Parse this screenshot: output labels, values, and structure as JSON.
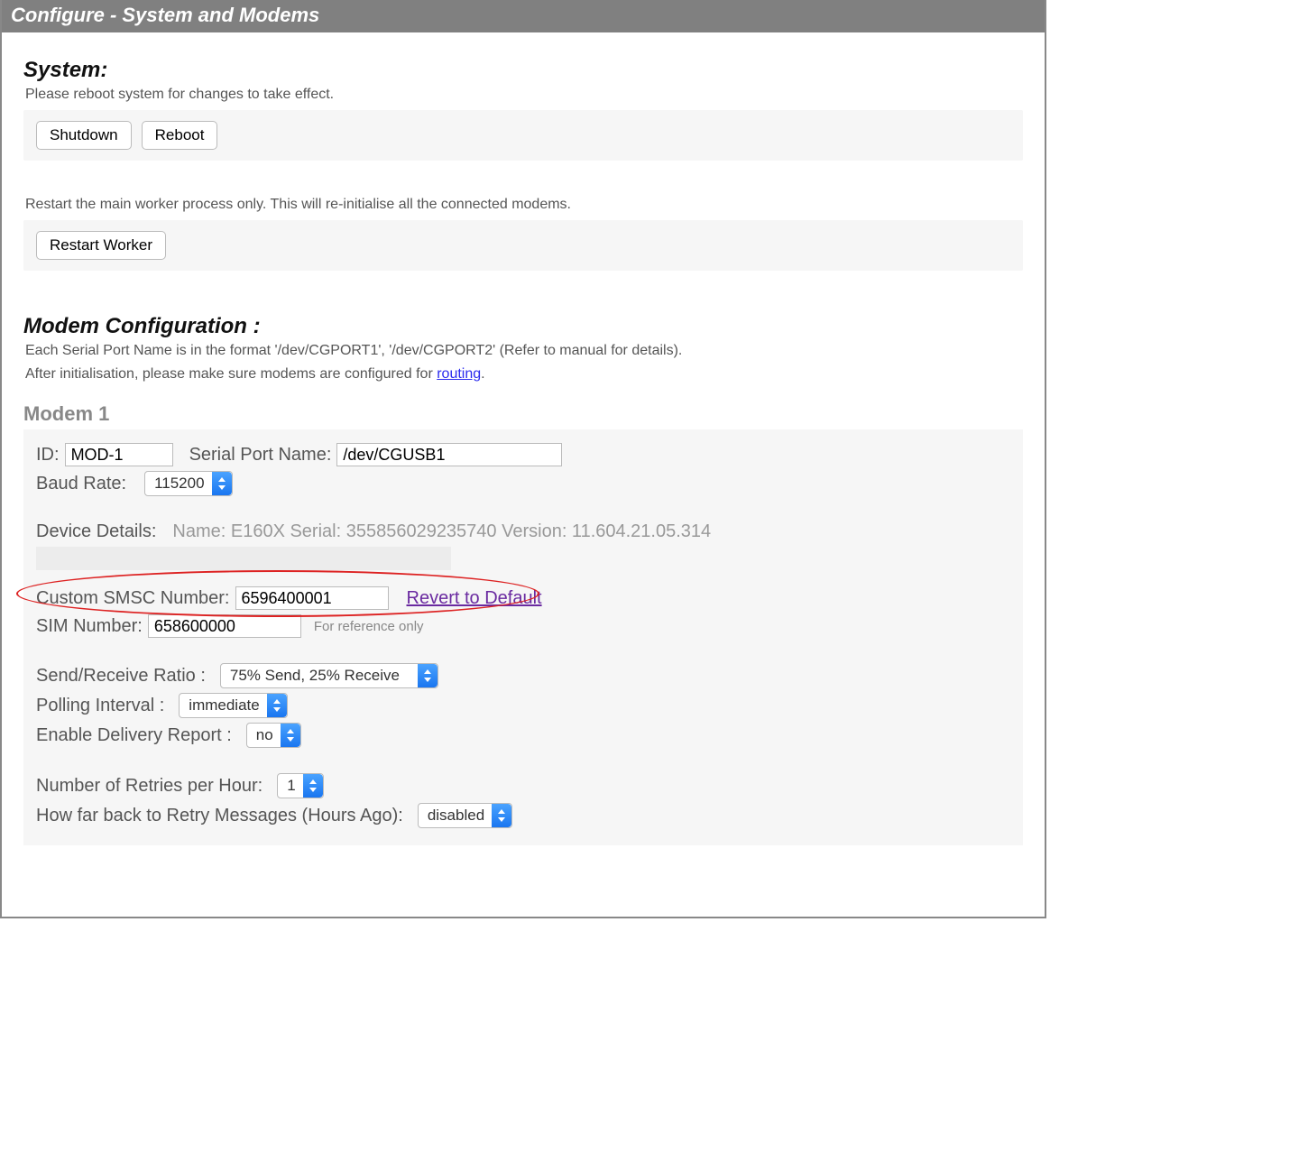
{
  "titlebar": "Configure - System and Modems",
  "system": {
    "heading": "System:",
    "note1": "Please reboot system for changes to take effect.",
    "shutdown_label": "Shutdown",
    "reboot_label": "Reboot",
    "note2": "Restart the main worker process only. This will re-initialise all the connected modems.",
    "restart_worker_label": "Restart Worker"
  },
  "modemcfg": {
    "heading": "Modem Configuration :",
    "note_line1": "Each Serial Port Name is in the format '/dev/CGPORT1', '/dev/CGPORT2' (Refer to manual for details).",
    "note_line2a": "After initialisation, please make sure modems are configured for ",
    "routing_link": "routing",
    "note_line2b": "."
  },
  "modem1": {
    "heading": "Modem 1",
    "id_label": "ID:",
    "id_value": "MOD-1",
    "serial_port_label": "Serial Port Name:",
    "serial_port_value": "/dev/CGUSB1",
    "baud_label": "Baud Rate:",
    "baud_value": "115200",
    "device_details_label": "Device Details:",
    "device_details_value": "Name: E160X Serial: 355856029235740 Version: 11.604.21.05.314",
    "smsc_label": "Custom SMSC Number:",
    "smsc_value": "6596400001",
    "revert_label": "Revert to Default",
    "sim_label": "SIM Number:",
    "sim_value": "658600000",
    "sim_note": "For reference only",
    "ratio_label": "Send/Receive Ratio :",
    "ratio_value": "75% Send, 25% Receive",
    "polling_label": "Polling Interval :",
    "polling_value": "immediate",
    "delivery_label": "Enable Delivery Report :",
    "delivery_value": "no",
    "retries_label": "Number of Retries per Hour:",
    "retries_value": "1",
    "retry_back_label": "How far back to Retry Messages (Hours Ago):",
    "retry_back_value": "disabled"
  }
}
